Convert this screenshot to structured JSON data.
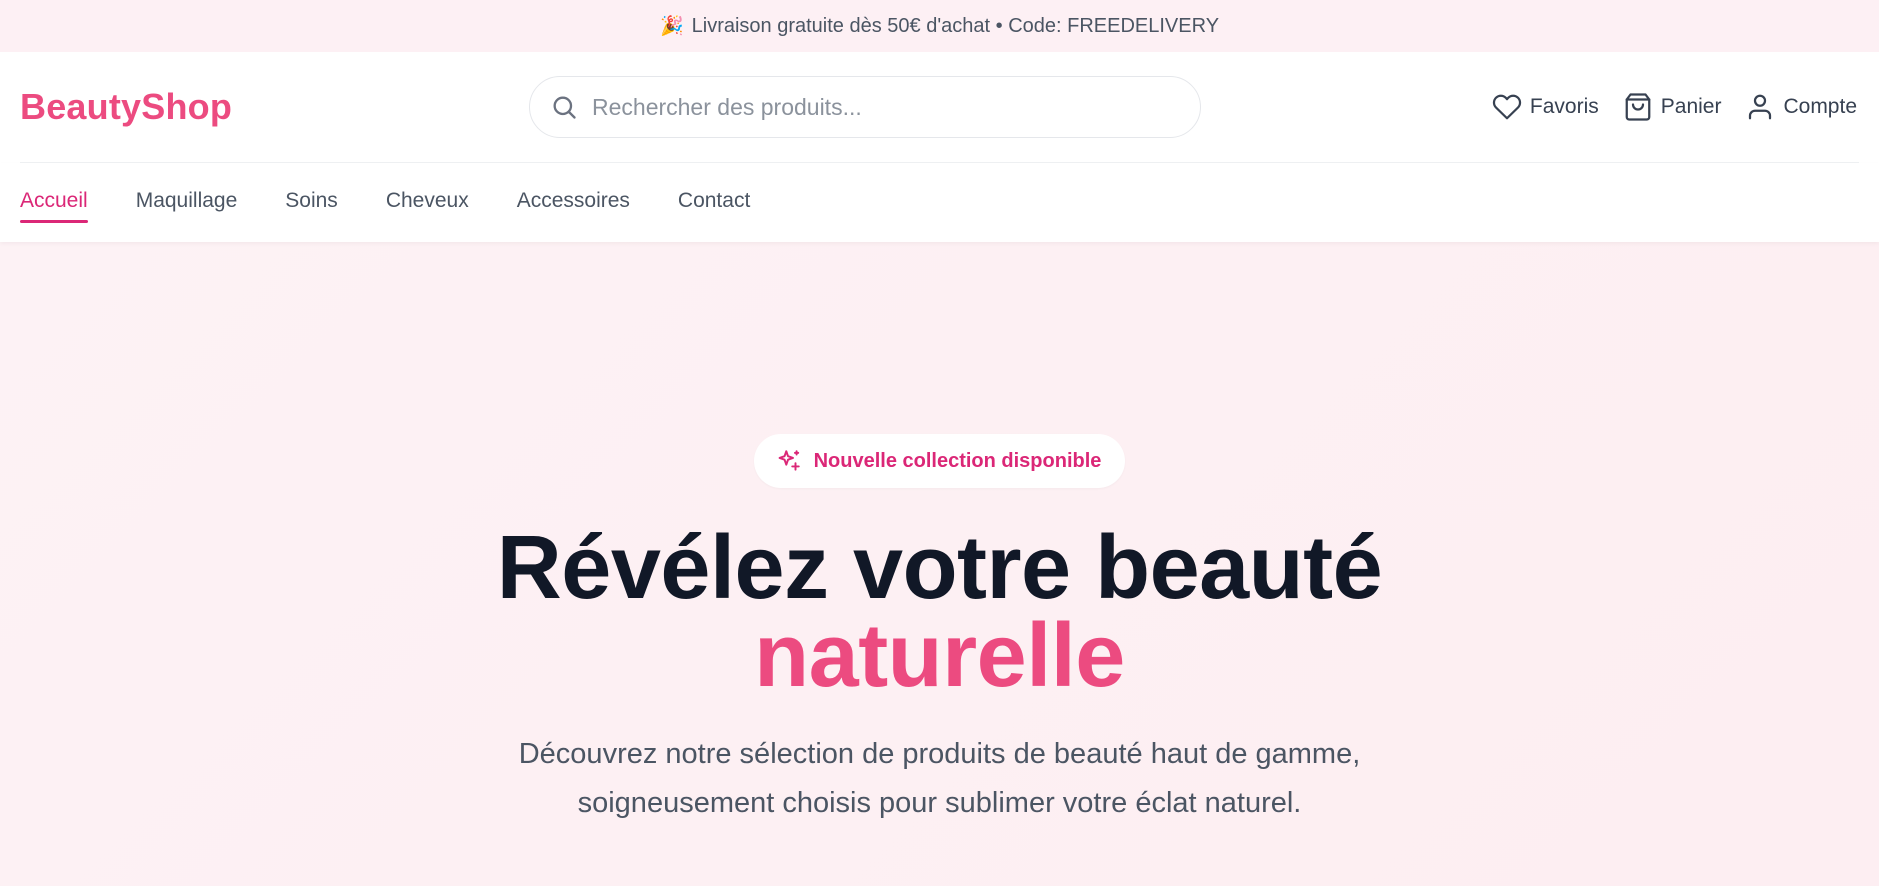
{
  "promo": {
    "icon": "party-popper-icon",
    "text": "Livraison gratuite dès 50€ d'achat • Code: FREEDELIVERY"
  },
  "header": {
    "logo": "BeautyShop",
    "search_placeholder": "Rechercher des produits...",
    "actions": [
      {
        "label": "Favoris",
        "icon": "heart-icon"
      },
      {
        "label": "Panier",
        "icon": "shopping-bag-icon"
      },
      {
        "label": "Compte",
        "icon": "user-icon"
      }
    ]
  },
  "nav": {
    "items": [
      {
        "label": "Accueil",
        "active": true
      },
      {
        "label": "Maquillage",
        "active": false
      },
      {
        "label": "Soins",
        "active": false
      },
      {
        "label": "Cheveux",
        "active": false
      },
      {
        "label": "Accessoires",
        "active": false
      },
      {
        "label": "Contact",
        "active": false
      }
    ]
  },
  "hero": {
    "badge": "Nouvelle collection disponible",
    "badge_icon": "sparkles-icon",
    "title_line1": "Révélez votre beauté",
    "title_line2": "naturelle",
    "subtitle_line1": "Découvrez notre sélection de produits de beauté haut de gamme,",
    "subtitle_line2": "soigneusement choisis pour sublimer votre éclat naturel."
  },
  "colors": {
    "brand": "#ec4b80",
    "accent": "#db2777",
    "promo_bg": "#fdf0f4",
    "hero_bg": "#fdf2f5"
  }
}
